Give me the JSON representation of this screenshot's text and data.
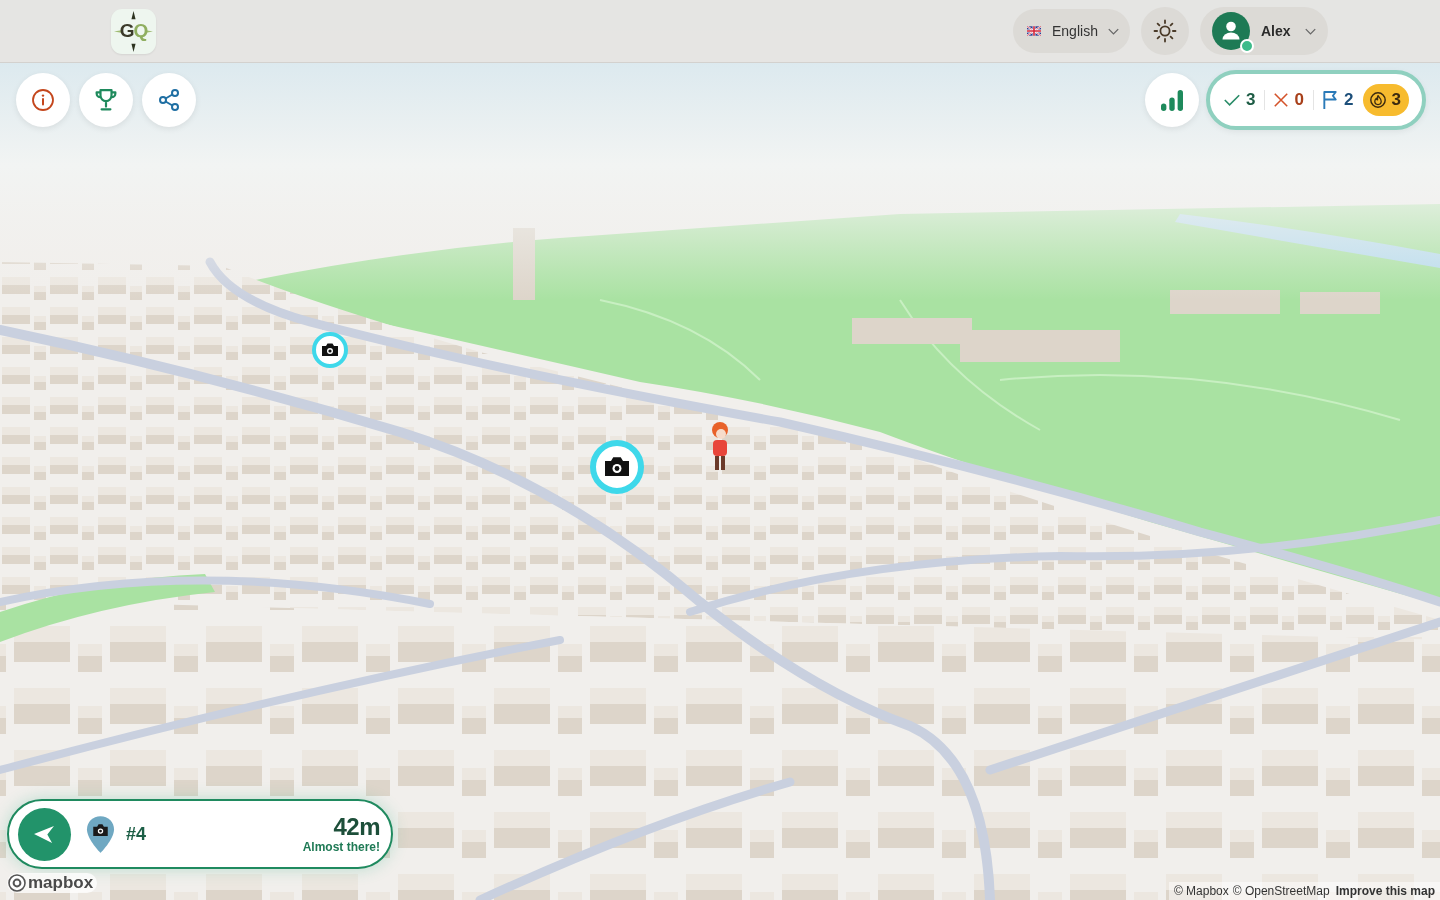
{
  "header": {
    "logo": {
      "text": "GQ"
    },
    "language": {
      "label": "English"
    },
    "user": {
      "name": "Alex",
      "online": true
    }
  },
  "score": {
    "items": [
      {
        "kind": "correct",
        "value": "3"
      },
      {
        "kind": "wrong",
        "value": "0"
      },
      {
        "kind": "flags",
        "value": "2"
      },
      {
        "kind": "streak",
        "value": "3"
      }
    ]
  },
  "target": {
    "number": "#4",
    "distance": "42m",
    "status": "Almost there!"
  },
  "map": {
    "logo": "mapbox",
    "attribution": [
      {
        "kind": "credit",
        "text": "© Mapbox"
      },
      {
        "kind": "credit",
        "text": "© OpenStreetMap"
      },
      {
        "kind": "feedback",
        "text": "Improve this map"
      }
    ]
  }
}
